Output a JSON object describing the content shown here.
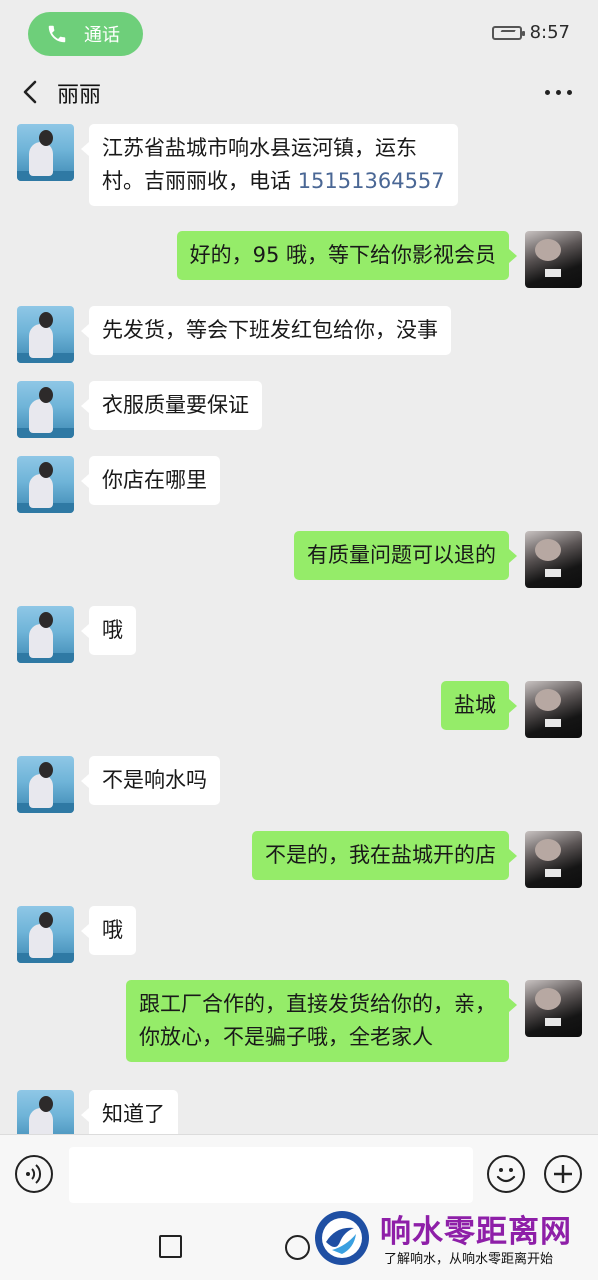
{
  "status": {
    "call_label": "通话",
    "time": "8:57"
  },
  "header": {
    "title": "丽丽"
  },
  "messages": [
    {
      "dir": "in",
      "lines": [
        "江苏省盐城市响水县运河镇，运东",
        "村。吉丽丽收，电话 "
      ],
      "phone": "15151364557"
    },
    {
      "dir": "out",
      "text": "好的，95 哦，等下给你影视会员"
    },
    {
      "dir": "in",
      "text": "先发货，等会下班发红包给你，没事"
    },
    {
      "dir": "in",
      "text": "衣服质量要保证"
    },
    {
      "dir": "in",
      "text": "你店在哪里"
    },
    {
      "dir": "out",
      "text": "有质量问题可以退的"
    },
    {
      "dir": "in",
      "text": "哦"
    },
    {
      "dir": "out",
      "text": "盐城"
    },
    {
      "dir": "in",
      "text": "不是响水吗"
    },
    {
      "dir": "out",
      "text": "不是的，我在盐城开的店"
    },
    {
      "dir": "in",
      "text": "哦"
    },
    {
      "dir": "out",
      "lines": [
        "跟工厂合作的，直接发货给你的，亲，",
        "你放心，不是骗子哦，全老家人"
      ]
    },
    {
      "dir": "in",
      "text": "知道了"
    }
  ],
  "input": {
    "value": "",
    "placeholder": ""
  },
  "icons": {
    "call": "phone-icon",
    "back": "back-arrow-icon",
    "more": "more-dots-icon",
    "voice": "voice-icon",
    "emoji": "emoji-icon",
    "plus": "plus-icon",
    "nav_recent": "square-icon",
    "nav_home": "circle-icon"
  },
  "colors": {
    "outgoing_bubble": "#95ec69",
    "incoming_bubble": "#ffffff",
    "call_pill": "#6ecf7a",
    "phone_link": "#4a6795",
    "watermark": "#8e1fa8"
  },
  "watermark": {
    "title": "响水零距离网",
    "subtitle": "了解响水，从响水零距离开始"
  }
}
